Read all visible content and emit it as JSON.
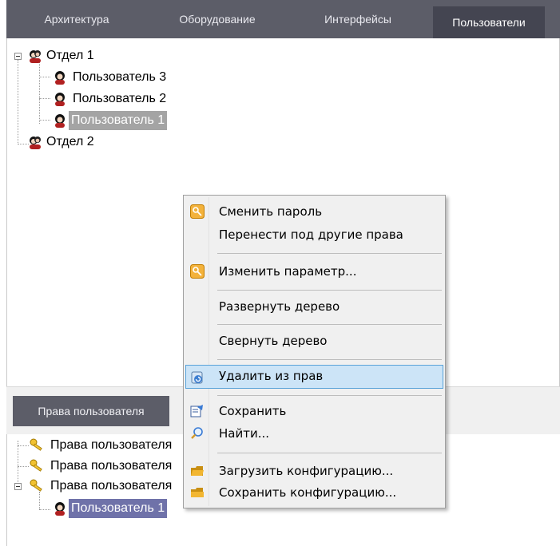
{
  "tabs": [
    {
      "label": "Архитектура",
      "active": false
    },
    {
      "label": "Оборудование",
      "active": false
    },
    {
      "label": "Интерфейсы",
      "active": false
    },
    {
      "label": "Пользователи",
      "active": true
    }
  ],
  "users_tree": {
    "dept1": "Отдел 1",
    "user3": "Пользователь 3",
    "user2": "Пользователь 2",
    "user1": "Пользователь 1",
    "dept2": "Отдел 2"
  },
  "rights_tab": "Права пользователя",
  "rights_tree": {
    "r1": "Права пользователя",
    "r2": "Права пользователя",
    "r3": "Права пользователя",
    "user1": "Пользователь 1"
  },
  "context_menu": {
    "change_password": "Сменить пароль",
    "move_rights": "Перенести под другие права",
    "change_param": "Изменить параметр...",
    "expand_tree": "Развернуть дерево",
    "collapse_tree": "Свернуть дерево",
    "remove_rights": "Удалить из прав",
    "save": "Сохранить",
    "find": "Найти...",
    "load_config": "Загрузить конфигурацию...",
    "save_config": "Сохранить конфигурацию..."
  },
  "icons": {
    "user": "user-avatar-icon",
    "group": "group-avatar-icon",
    "key": "key-icon",
    "password": "key-badge-icon",
    "remove": "remove-rights-icon",
    "save": "save-icon",
    "find": "magnifier-icon",
    "load": "folder-open-icon",
    "save_config": "folder-save-icon"
  },
  "colors": {
    "tabbar": "#5c5d68",
    "tab_active": "#444551",
    "selection_gray": "#a4a4a4",
    "selection_blue": "#6f72a9",
    "menu_highlight": "#cce4f7"
  }
}
